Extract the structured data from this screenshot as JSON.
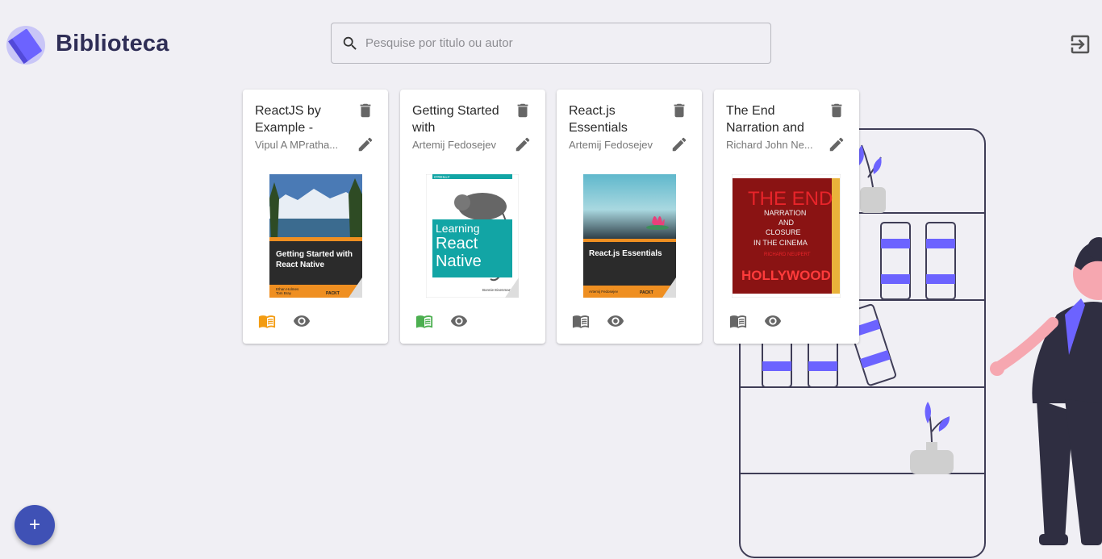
{
  "header": {
    "app_title": "Biblioteca",
    "search_placeholder": "Pesquise por titulo ou autor",
    "search_value": ""
  },
  "books": [
    {
      "title": "ReactJS by Example -",
      "author": "Vipul A MPratha...",
      "status_color": "#f39c12",
      "cover": {
        "title_lines": [
          "Getting Started with",
          "React Native"
        ],
        "authors": [
          "Ethan Holmes",
          "Tom Bray"
        ],
        "publisher": "PACKT"
      }
    },
    {
      "title": "Getting Started with",
      "author": "Artemij Fedosejev",
      "status_color": "#4caf50",
      "cover": {
        "brand": "O'REILLY",
        "title_lines": [
          "Learning",
          "React",
          "Native"
        ],
        "authors": [
          "Bonnie Eisenman"
        ]
      }
    },
    {
      "title": "React.js Essentials",
      "author": "Artemij Fedosejev",
      "status_color": "#666666",
      "cover": {
        "title_lines": [
          "React.js Essentials"
        ],
        "authors": [
          "Artemij Fedosejev"
        ],
        "publisher": "PACKT"
      }
    },
    {
      "title": "The End Narration and",
      "author": "Richard John Ne...",
      "status_color": "#666666",
      "cover": {
        "title_lines": [
          "THE END",
          "NARRATION",
          "AND",
          "CLOSURE",
          "IN THE CINEMA"
        ],
        "authors": [
          "RICHARD NEUPERT"
        ],
        "footer": "HOLLYWOOD"
      }
    }
  ],
  "colors": {
    "accent": "#3f51b5",
    "brand": "#2f2e56",
    "illustration_purple": "#6c63ff"
  },
  "icons": {
    "logo": "book-logo-icon",
    "search": "search-icon",
    "logout": "logout-icon",
    "delete": "trash-icon",
    "edit": "pencil-icon",
    "read": "open-book-icon",
    "view": "eye-icon",
    "add": "plus-icon"
  },
  "fab": {
    "label": "+"
  }
}
